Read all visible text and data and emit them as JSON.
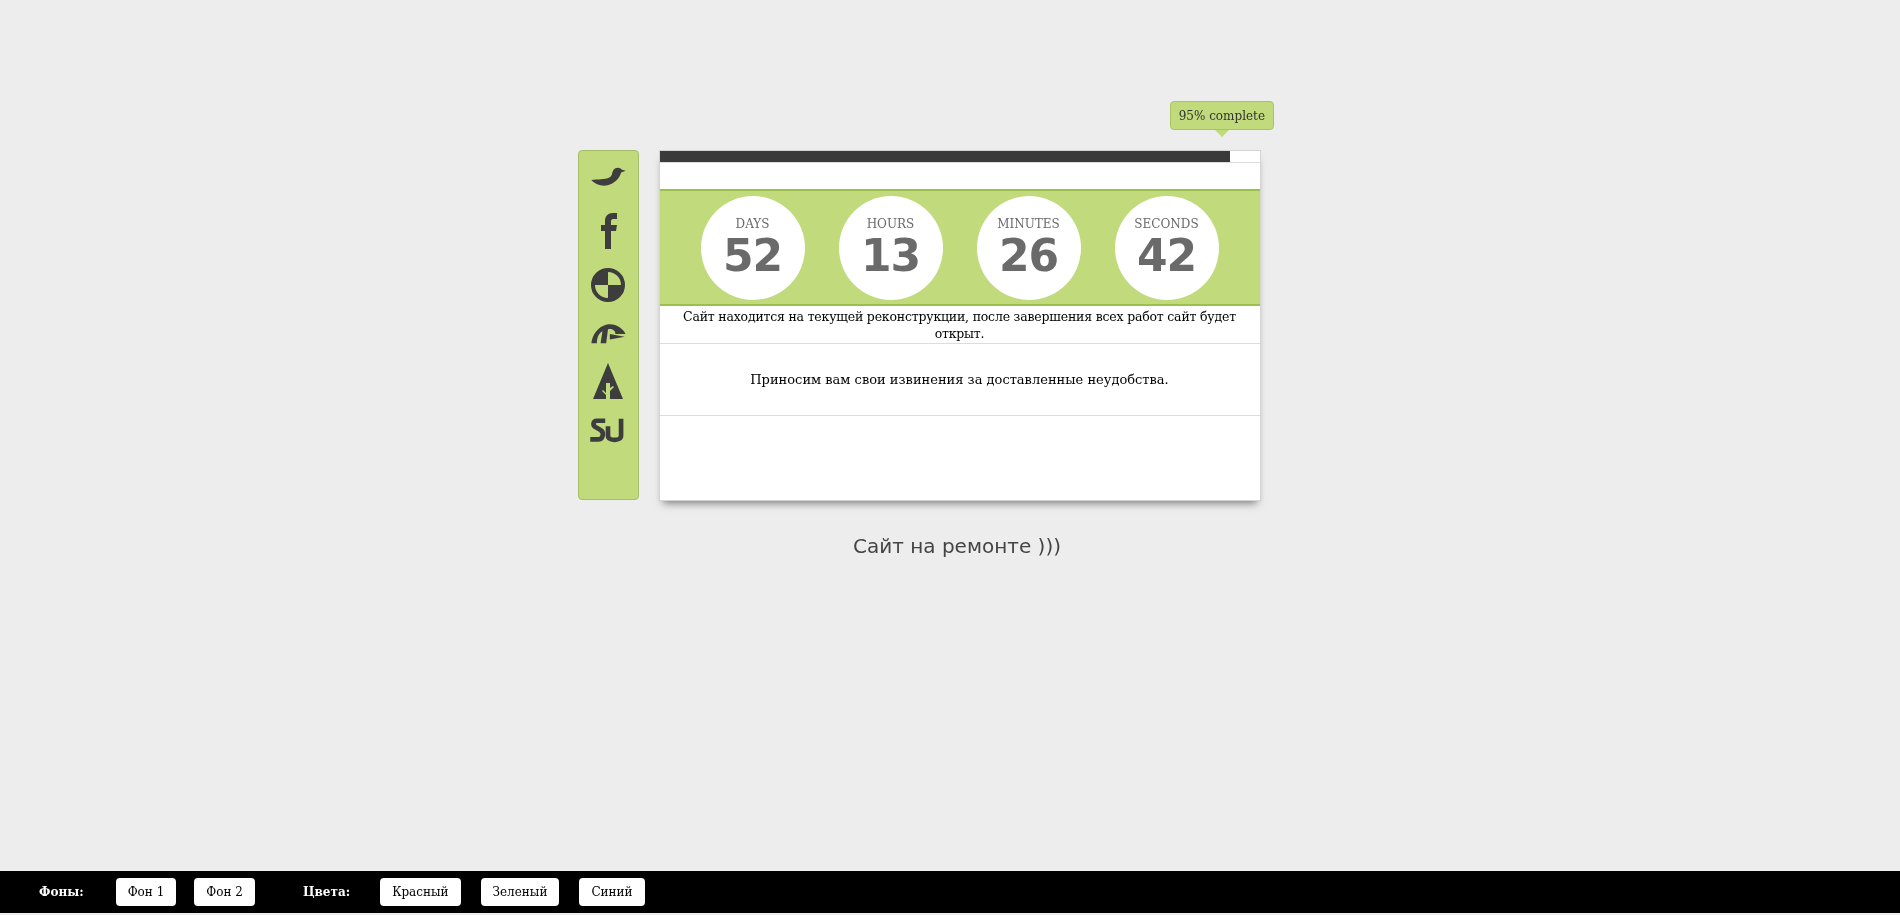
{
  "progress": {
    "level": 0.95,
    "tooltip": "95% complete"
  },
  "social": [
    {
      "kind": "bird"
    },
    {
      "kind": "f"
    },
    {
      "kind": "ball"
    },
    {
      "kind": "da"
    },
    {
      "kind": "tree"
    },
    {
      "kind": "su"
    }
  ],
  "countdown": [
    {
      "label": "DAYS",
      "value": "52"
    },
    {
      "label": "HOURS",
      "value": "13"
    },
    {
      "label": "MINUTES",
      "value": "26"
    },
    {
      "label": "SECONDS",
      "value": "42"
    }
  ],
  "message": "Сайт находится на текущей реконструкции, после завершения всех работ сайт будет открыт.",
  "apology": "Приносим вам свои извинения за доставленные неудобства.",
  "caption": "Сайт на ремонте )))",
  "footer": {
    "backgrounds_label": "Фоны:",
    "backgrounds": [
      "Фон 1",
      "Фон 2"
    ],
    "colors_label": "Цвета:",
    "colors": [
      "Красный",
      "Зеленый",
      "Синий"
    ]
  }
}
